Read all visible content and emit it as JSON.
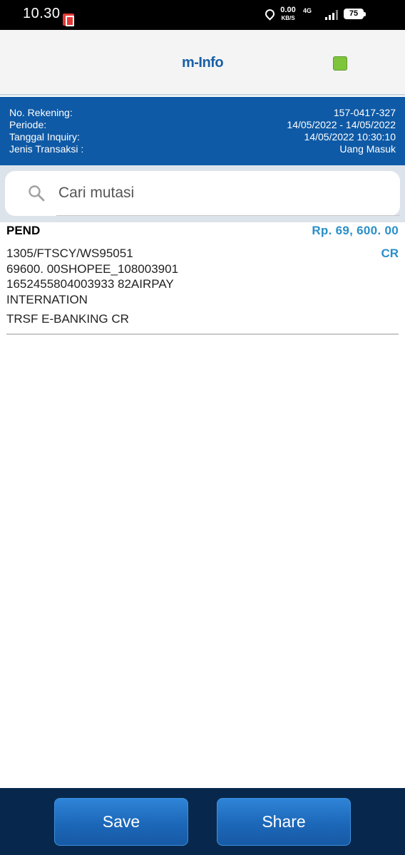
{
  "status_bar": {
    "time": "10.30",
    "speed_value": "0.00",
    "speed_unit": "KB/S",
    "network": "4G",
    "battery": "75"
  },
  "header": {
    "title": "m-Info",
    "status_color": "#7ec53b"
  },
  "info": {
    "rows": [
      {
        "label": "No. Rekening:",
        "value": "157-0417-327"
      },
      {
        "label": "Periode:",
        "value": "14/05/2022 - 14/05/2022"
      },
      {
        "label": "Tanggal Inquiry:",
        "value": "14/05/2022 10:30:10"
      },
      {
        "label": "Jenis Transaksi :",
        "value": "Uang Masuk"
      }
    ]
  },
  "search": {
    "placeholder": "Cari mutasi",
    "value": ""
  },
  "transactions": [
    {
      "status": "PEND",
      "amount": "Rp.  69, 600. 00",
      "type": "CR",
      "description_lines": [
        "1305/FTSCY/WS95051",
        "69600. 00SHOPEE_108003901",
        "1652455804003933 82AIRPAY",
        "INTERNATION"
      ],
      "category": "TRSF E-BANKING CR"
    }
  ],
  "actions": {
    "save_label": "Save",
    "share_label": "Share"
  },
  "colors": {
    "brand_blue": "#0f5aa6",
    "amount_blue": "#2a8fc9",
    "bottom_bar": "#07284c"
  }
}
